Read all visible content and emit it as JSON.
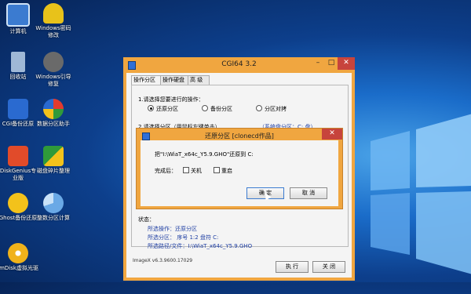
{
  "desktop": {
    "icons": [
      {
        "label": "计算机",
        "color": "#3b7bd0"
      },
      {
        "label": "Windows密码修改",
        "color": "#e8c21a"
      },
      {
        "label": "回收站",
        "color": "#9fb8d6"
      },
      {
        "label": "Windows引导修复",
        "color": "#6a6a6a"
      },
      {
        "label": "CGI备份还原",
        "color": "#2a6ad0"
      },
      {
        "label": "数据分区助手",
        "color": "#25a84a"
      },
      {
        "label": "DiskGenius专业版",
        "color": "#e14b2a"
      },
      {
        "label": "磁盘碎片整理",
        "color": "#2f9a3a"
      },
      {
        "label": "Ghost备份还原",
        "color": "#f3c21b"
      },
      {
        "label": "整数分区计算",
        "color": "#6aa9e6"
      },
      {
        "label": "ImDisk虚拟光驱",
        "color": "#f0b21a"
      }
    ]
  },
  "window": {
    "title": "CGI64  3.2",
    "min_glyph": "–",
    "max_glyph": "□",
    "close_glyph": "✕",
    "tabs": [
      "操作分区",
      "操作硬盘",
      "高 级"
    ],
    "step1_label": "1.请选择您要进行的操作：",
    "options": [
      "还原分区",
      "备份分区",
      "分区对拷"
    ],
    "step2_label": "2.请选择分区（用鼠标左键单击）",
    "sys_partition": "（系统盘分区：C: 盘）",
    "status_label": "状态：",
    "status_lines": [
      "所选操作：还原分区",
      "所选分区：  序号 1:2      盘符 C:",
      "所选路径/文件：I:\\WiaT_x64c_Y5.9.GHO"
    ],
    "version": "ImageX  v6.3.9600.17029",
    "execute_button": "执 行",
    "close_button": "关 闭"
  },
  "dialog": {
    "title": "还原分区 [clonecd作品]",
    "close_glyph": "✕",
    "message": "把\"I:\\WiaT_x64c_Y5.9.GHO\"还原到 C:",
    "after_label": "完成后：",
    "shutdown_label": "关机",
    "restart_label": "重启",
    "ok_button": "确 定",
    "cancel_button": "取 消"
  }
}
